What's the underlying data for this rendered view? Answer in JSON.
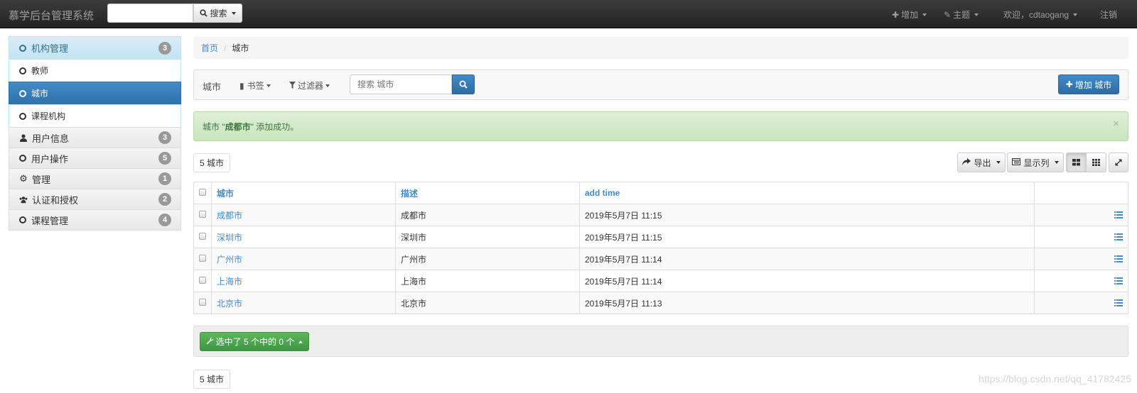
{
  "navbar": {
    "brand": "慕学后台管理系统",
    "search_button": "搜索",
    "add": "增加",
    "theme": "主题",
    "welcome": "欢迎，cdtaogang",
    "logout": "注销"
  },
  "sidebar": {
    "groups": [
      {
        "label": "机构管理",
        "count": "3",
        "items": [
          "教师",
          "城市",
          "课程机构"
        ]
      },
      {
        "label": "用户信息",
        "count": "3"
      },
      {
        "label": "用户操作",
        "count": "5"
      },
      {
        "label": "管理",
        "count": "1"
      },
      {
        "label": "认证和授权",
        "count": "2"
      },
      {
        "label": "课程管理",
        "count": "4"
      }
    ],
    "active_item": "城市"
  },
  "breadcrumb": {
    "home": "首页",
    "current": "城市"
  },
  "toolbar": {
    "title": "城市",
    "bookmarks": "书签",
    "filters": "过滤器",
    "search_placeholder": "搜索 城市",
    "add_button": "增加 城市"
  },
  "alert": {
    "prefix": "城市 \"",
    "name": "成都市",
    "suffix": "\" 添加成功。",
    "close": "×"
  },
  "result_count": {
    "number": "5",
    "label": "城市"
  },
  "tools": {
    "export": "导出",
    "columns": "显示列"
  },
  "table": {
    "headers": [
      "城市",
      "描述",
      "add time"
    ],
    "rows": [
      {
        "name": "成都市",
        "desc": "成都市",
        "time": "2019年5月7日 11:15"
      },
      {
        "name": "深圳市",
        "desc": "深圳市",
        "time": "2019年5月7日 11:15"
      },
      {
        "name": "广州市",
        "desc": "广州市",
        "time": "2019年5月7日 11:14"
      },
      {
        "name": "上海市",
        "desc": "上海市",
        "time": "2019年5月7日 11:14"
      },
      {
        "name": "北京市",
        "desc": "北京市",
        "time": "2019年5月7日 11:13"
      }
    ]
  },
  "actions": {
    "selected": "选中了 5 个中的 0 个"
  },
  "watermark": "https://blog.csdn.net/qq_41782425",
  "colors": {
    "primary": "#428bca",
    "success": "#5cb85c",
    "navbar": "#222222"
  }
}
